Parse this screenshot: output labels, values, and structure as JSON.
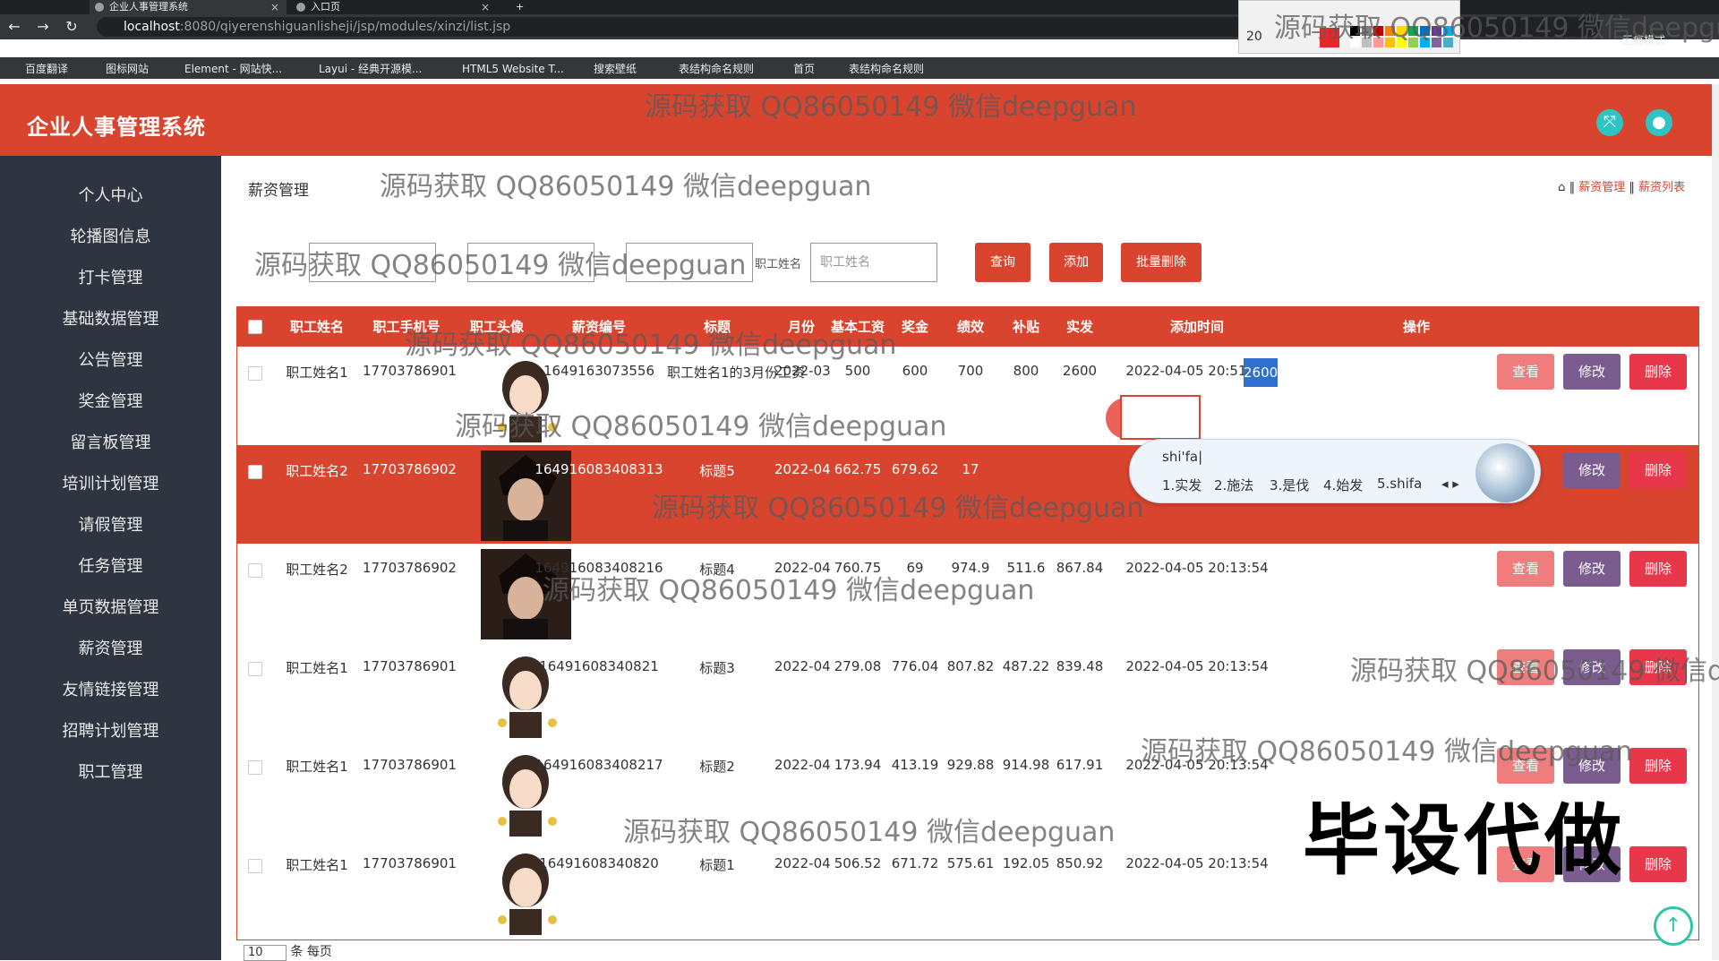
{
  "browser": {
    "tabs": [
      {
        "label": "企业人事管理系统",
        "active": true
      },
      {
        "label": "入口页",
        "active": false
      }
    ],
    "url_host": "localhost",
    "url_path": ":8080/qiyerenshiguanlisheji/jsp/modules/xinzi/list.jsp",
    "profile_label": "无痕模式",
    "bookmarks": [
      "百度翻译",
      "图标网站",
      "Element - 网站快...",
      "Layui - 经典开源模...",
      "HTML5 Website T...",
      "搜索壁纸",
      "表结构命名规则",
      "首页",
      "表结构命名规则"
    ],
    "palette_size": "20"
  },
  "app": {
    "title": "企业人事管理系统"
  },
  "sidebar": {
    "items": [
      "个人中心",
      "轮播图信息",
      "打卡管理",
      "基础数据管理",
      "公告管理",
      "奖金管理",
      "留言板管理",
      "培训计划管理",
      "请假管理",
      "任务管理",
      "单页数据管理",
      "薪资管理",
      "友情链接管理",
      "招聘计划管理",
      "职工管理"
    ]
  },
  "main": {
    "heading": "薪资管理",
    "breadcrumb": [
      "薪资管理",
      "薪资列表"
    ],
    "search": {
      "field4_label": "职工姓名",
      "field4_placeholder": "职工姓名",
      "query_btn": "查询",
      "add_btn": "添加",
      "batch_delete_btn": "批量删除"
    },
    "table": {
      "headers": [
        "职工姓名",
        "职工手机号",
        "职工头像",
        "薪资编号",
        "标题",
        "月份",
        "基本工资",
        "奖金",
        "绩效",
        "补贴",
        "实发",
        "添加时间",
        "操作"
      ],
      "rows": [
        {
          "name": "职工姓名1",
          "phone": "17703786901",
          "avatar": "girl",
          "salary_no": "1649163073556",
          "title": "职工姓名1的3月份工资",
          "month": "2022-03",
          "base": "500",
          "bonus": "600",
          "perf": "700",
          "subsidy": "800",
          "net": "2600",
          "added": "2022-04-05 20:51:38"
        },
        {
          "name": "职工姓名2",
          "phone": "17703786902",
          "avatar": "boy",
          "salary_no": "164916083408313",
          "title": "标题5",
          "month": "2022-04",
          "base": "662.75",
          "bonus": "679.62",
          "perf": "17",
          "subsidy": "",
          "net": "",
          "added": ""
        },
        {
          "name": "职工姓名2",
          "phone": "17703786902",
          "avatar": "boy",
          "salary_no": "164916083408216",
          "title": "标题4",
          "month": "2022-04",
          "base": "760.75",
          "bonus": "69",
          "perf": "974.9",
          "subsidy": "511.6",
          "net": "867.84",
          "added": "2022-04-05 20:13:54"
        },
        {
          "name": "职工姓名1",
          "phone": "17703786901",
          "avatar": "girl",
          "salary_no": "16491608340821",
          "title": "标题3",
          "month": "2022-04",
          "base": "279.08",
          "bonus": "776.04",
          "perf": "807.82",
          "subsidy": "487.22",
          "net": "839.48",
          "added": "2022-04-05 20:13:54"
        },
        {
          "name": "职工姓名1",
          "phone": "17703786901",
          "avatar": "girl",
          "salary_no": "164916083408217",
          "title": "标题2",
          "month": "2022-04",
          "base": "173.94",
          "bonus": "413.19",
          "perf": "929.88",
          "subsidy": "914.98",
          "net": "617.91",
          "added": "2022-04-05 20:13:54"
        },
        {
          "name": "职工姓名1",
          "phone": "17703786901",
          "avatar": "girl",
          "salary_no": "16491608340820",
          "title": "标题1",
          "month": "2022-04",
          "base": "506.52",
          "bonus": "671.72",
          "perf": "575.61",
          "subsidy": "192.05",
          "net": "850.92",
          "added": "2022-04-05 20:13:54"
        }
      ],
      "actions": {
        "view": "查看",
        "edit": "修改",
        "delete": "删除"
      }
    },
    "pager": {
      "page_size": "10",
      "suffix": "条 每页"
    }
  },
  "ime": {
    "input": "shi'fa|",
    "candidates": [
      "1.实发",
      "2.施法",
      "3.是伐",
      "4.始发",
      "5.shifa"
    ]
  },
  "overlays": {
    "watermark": "源码获取 QQ86050149 微信deepguan",
    "stamp": "毕设代做"
  },
  "colors": {
    "brand": "#d9442e",
    "sidebar": "#2e3540",
    "accent_teal": "#2ec4c4"
  }
}
